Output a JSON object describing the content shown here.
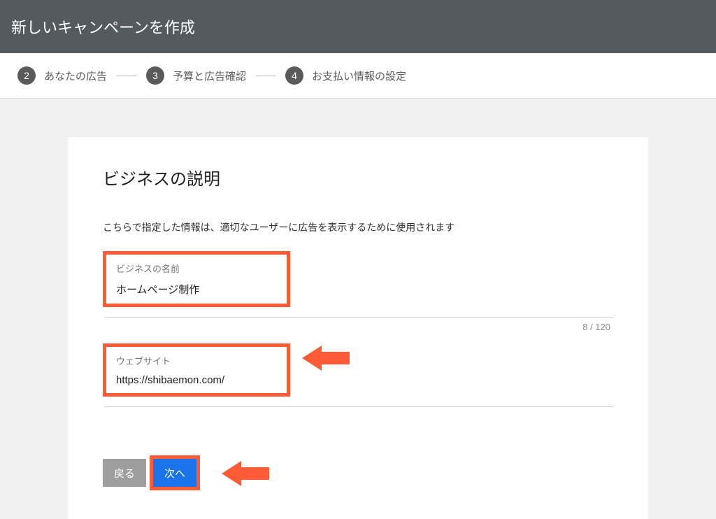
{
  "header": {
    "title": "新しいキャンペーンを作成"
  },
  "stepper": {
    "steps": [
      {
        "num": "2",
        "label": "あなたの広告"
      },
      {
        "num": "3",
        "label": "予算と広告確認"
      },
      {
        "num": "4",
        "label": "お支払い情報の設定"
      }
    ]
  },
  "page": {
    "title": "ビジネスの説明",
    "helper": "こちらで指定した情報は、適切なユーザーに広告を表示するために使用されます",
    "business_name_label": "ビジネスの名前",
    "business_name_value": "ホームページ制作",
    "counter": "8 / 120",
    "website_label": "ウェブサイト",
    "website_value": "https://shibaemon.com/"
  },
  "buttons": {
    "back": "戻る",
    "next": "次へ"
  },
  "annotations": {
    "arrow_color": "#fe5b36"
  }
}
